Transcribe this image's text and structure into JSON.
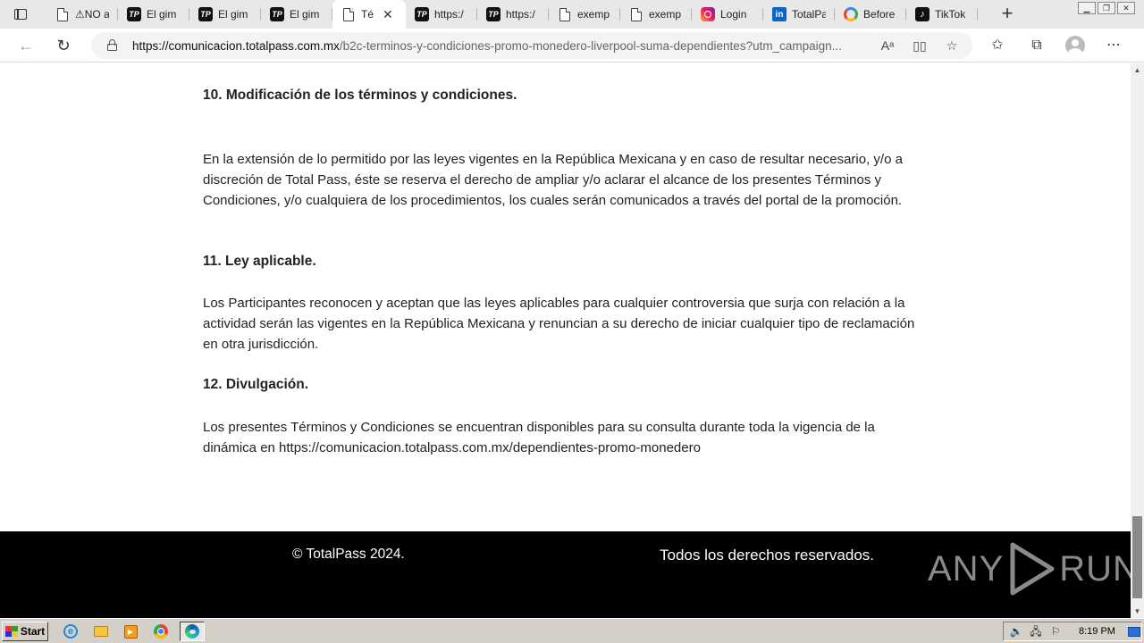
{
  "browser": {
    "tabs": [
      {
        "title": "⚠NO a",
        "icon": "document-icon"
      },
      {
        "title": "El gim",
        "icon": "totalpass-icon"
      },
      {
        "title": "El gim",
        "icon": "totalpass-icon"
      },
      {
        "title": "El gim",
        "icon": "totalpass-icon"
      },
      {
        "title": "Té",
        "icon": "document-icon",
        "active": true
      },
      {
        "title": "https:/",
        "icon": "totalpass-icon"
      },
      {
        "title": "https:/",
        "icon": "totalpass-icon"
      },
      {
        "title": "exemp",
        "icon": "document-icon"
      },
      {
        "title": "exemp",
        "icon": "document-icon"
      },
      {
        "title": "Login",
        "icon": "instagram-icon"
      },
      {
        "title": "TotalPa",
        "icon": "linkedin-icon"
      },
      {
        "title": "Before",
        "icon": "google-icon"
      },
      {
        "title": "TikTok",
        "icon": "tiktok-icon"
      }
    ],
    "url_host": "https://comunicacion.totalpass.com.mx",
    "url_path": "/b2c-terminos-y-condiciones-promo-monedero-liverpool-suma-dependientes?utm_campaign..."
  },
  "content": {
    "s10_title": "10. Modificación de los términos y condiciones.",
    "s10_body": "En la extensión de lo permitido por las leyes vigentes en la República Mexicana y en caso de resultar necesario, y/o a discreción de Total Pass, éste se reserva el derecho de ampliar y/o aclarar el alcance de los presentes Términos y Condiciones, y/o cualquiera de los procedimientos, los cuales serán comunicados a través del portal de la promoción.",
    "s11_title": "11. Ley aplicable.",
    "s11_body": "Los Participantes reconocen y aceptan que las leyes aplicables para cualquier controversia que surja con relación a la actividad serán las vigentes en la República Mexicana y renuncian a su derecho de iniciar cualquier tipo de reclamación en otra jurisdicción.",
    "s12_title": "12. Divulgación.",
    "s12_body": "Los presentes Términos y Condiciones se encuentran disponibles para su consulta durante toda la vigencia de la dinámica en https://comunicacion.totalpass.com.mx/dependientes-promo-monedero"
  },
  "footer": {
    "copyright": "© TotalPass 2024.",
    "rights": "Todos los derechos reservados."
  },
  "watermark": {
    "left": "ANY",
    "right": "RUN"
  },
  "taskbar": {
    "start_label": "Start",
    "clock": "8:19 PM"
  }
}
